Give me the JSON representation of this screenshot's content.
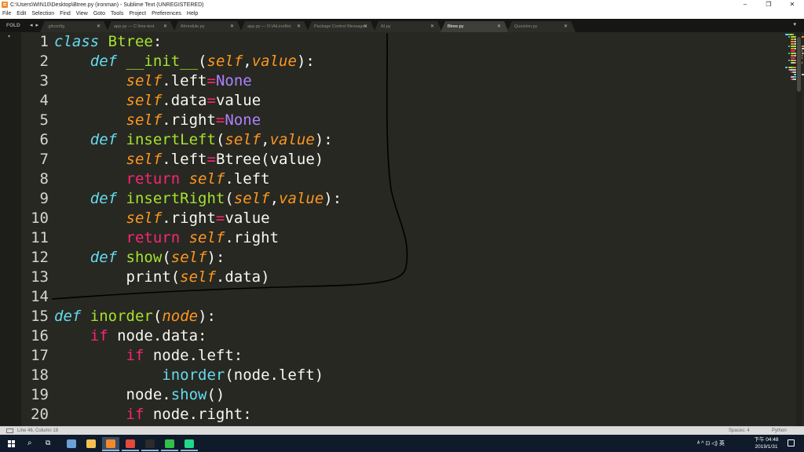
{
  "window": {
    "title": "C:\\Users\\WIN10\\Desktop\\Btree.py (ironman) - Sublime Text (UNREGISTERED)",
    "minimize": "–",
    "maximize": "❐",
    "close": "✕"
  },
  "menu": [
    "File",
    "Edit",
    "Selection",
    "Find",
    "View",
    "Goto",
    "Tools",
    "Project",
    "Preferences",
    "Help"
  ],
  "tabbar": {
    "folder_label": "FOLD",
    "nav": "◂ ▸",
    "tabs": [
      {
        "label": ".gitconfig",
        "active": false
      },
      {
        "label": "app.py — C:\\line-test",
        "active": false
      },
      {
        "label": "AImodule.py",
        "active": false
      },
      {
        "label": "app.py — D:\\AiLineBot",
        "active": false
      },
      {
        "label": "Package Control Messages",
        "active": false
      },
      {
        "label": "AI.py",
        "active": false
      },
      {
        "label": "Btree.py",
        "active": true
      },
      {
        "label": "Question.py",
        "active": false
      }
    ],
    "close_glyph": "✕",
    "dropdown": "▾"
  },
  "editor": {
    "language": "Python",
    "theme": {
      "background": "#272822",
      "keyword": "#f92672",
      "storage": "#66d9ef",
      "function": "#a6e22e",
      "self": "#fd971f",
      "constant": "#ae81ff",
      "text": "#f8f8f2"
    },
    "line_numbers": [
      "1",
      "2",
      "3",
      "4",
      "5",
      "6",
      "7",
      "8",
      "9",
      "10",
      "11",
      "12",
      "13",
      "14",
      "15",
      "16",
      "17",
      "18",
      "19",
      "20"
    ],
    "lines": [
      [
        [
          "k",
          "class"
        ],
        [
          "t",
          " "
        ],
        [
          "cls",
          "Btree"
        ],
        [
          "t",
          ":"
        ]
      ],
      [
        [
          "t",
          "    "
        ],
        [
          "k",
          "def"
        ],
        [
          "t",
          " "
        ],
        [
          "fn",
          "__init__"
        ],
        [
          "t",
          "("
        ],
        [
          "sf",
          "self"
        ],
        [
          "t",
          ","
        ],
        [
          "sf",
          "value"
        ],
        [
          "t",
          "):"
        ]
      ],
      [
        [
          "t",
          "        "
        ],
        [
          "sf",
          "self"
        ],
        [
          "t",
          ".left"
        ],
        [
          "op",
          "="
        ],
        [
          "cst",
          "None"
        ]
      ],
      [
        [
          "t",
          "        "
        ],
        [
          "sf",
          "self"
        ],
        [
          "t",
          ".data"
        ],
        [
          "op",
          "="
        ],
        [
          "t",
          "value"
        ]
      ],
      [
        [
          "t",
          "        "
        ],
        [
          "sf",
          "self"
        ],
        [
          "t",
          ".right"
        ],
        [
          "op",
          "="
        ],
        [
          "cst",
          "None"
        ]
      ],
      [
        [
          "t",
          "    "
        ],
        [
          "k",
          "def"
        ],
        [
          "t",
          " "
        ],
        [
          "fn",
          "insertLeft"
        ],
        [
          "t",
          "("
        ],
        [
          "sf",
          "self"
        ],
        [
          "t",
          ","
        ],
        [
          "sf",
          "value"
        ],
        [
          "t",
          "):"
        ]
      ],
      [
        [
          "t",
          "        "
        ],
        [
          "sf",
          "self"
        ],
        [
          "t",
          ".left"
        ],
        [
          "op",
          "="
        ],
        [
          "t",
          "Btree(value)"
        ]
      ],
      [
        [
          "t",
          "        "
        ],
        [
          "kw",
          "return"
        ],
        [
          "t",
          " "
        ],
        [
          "sf",
          "self"
        ],
        [
          "t",
          ".left"
        ]
      ],
      [
        [
          "t",
          "    "
        ],
        [
          "k",
          "def"
        ],
        [
          "t",
          " "
        ],
        [
          "fn",
          "insertRight"
        ],
        [
          "t",
          "("
        ],
        [
          "sf",
          "self"
        ],
        [
          "t",
          ","
        ],
        [
          "sf",
          "value"
        ],
        [
          "t",
          "):"
        ]
      ],
      [
        [
          "t",
          "        "
        ],
        [
          "sf",
          "self"
        ],
        [
          "t",
          ".right"
        ],
        [
          "op",
          "="
        ],
        [
          "t",
          "value"
        ]
      ],
      [
        [
          "t",
          "        "
        ],
        [
          "kw",
          "return"
        ],
        [
          "t",
          " "
        ],
        [
          "sf",
          "self"
        ],
        [
          "t",
          ".right"
        ]
      ],
      [
        [
          "t",
          "    "
        ],
        [
          "k",
          "def"
        ],
        [
          "t",
          " "
        ],
        [
          "fn",
          "show"
        ],
        [
          "t",
          "("
        ],
        [
          "sf",
          "self"
        ],
        [
          "t",
          "):"
        ]
      ],
      [
        [
          "t",
          "        "
        ],
        [
          "t",
          "print("
        ],
        [
          "sf",
          "self"
        ],
        [
          "t",
          ".data)"
        ]
      ],
      [
        [
          "t",
          ""
        ]
      ],
      [
        [
          "k",
          "def"
        ],
        [
          "t",
          " "
        ],
        [
          "fn",
          "inorder"
        ],
        [
          "t",
          "("
        ],
        [
          "sf",
          "node"
        ],
        [
          "t",
          "):"
        ]
      ],
      [
        [
          "t",
          "    "
        ],
        [
          "kw",
          "if"
        ],
        [
          "t",
          " node.data:"
        ]
      ],
      [
        [
          "t",
          "        "
        ],
        [
          "kw",
          "if"
        ],
        [
          "t",
          " node.left:"
        ]
      ],
      [
        [
          "t",
          "            "
        ],
        [
          "bi",
          "inorder"
        ],
        [
          "t",
          "(node.left)"
        ]
      ],
      [
        [
          "t",
          "        "
        ],
        [
          "t",
          "node."
        ],
        [
          "bi",
          "show"
        ],
        [
          "t",
          "()"
        ]
      ],
      [
        [
          "t",
          "        "
        ],
        [
          "kw",
          "if"
        ],
        [
          "t",
          " node.right:"
        ]
      ]
    ]
  },
  "statusbar": {
    "position": "Line 46, Column 18",
    "spaces": "Spaces: 4",
    "syntax": "Python"
  },
  "taskbar": {
    "apps": [
      {
        "name": "ie-icon",
        "color": "#6aa0d8",
        "active": false,
        "pinned": false
      },
      {
        "name": "file-explorer-icon",
        "color": "#f2c14e",
        "active": false,
        "pinned": false
      },
      {
        "name": "sublime-text-icon",
        "color": "#f18a2c",
        "active": true,
        "pinned": true
      },
      {
        "name": "chrome-icon",
        "color": "#e24a3b",
        "active": false,
        "pinned": true
      },
      {
        "name": "terminal-icon",
        "color": "#2b2b2b",
        "active": false,
        "pinned": true
      },
      {
        "name": "line-app-icon",
        "color": "#2fc246",
        "active": false,
        "pinned": true
      },
      {
        "name": "pycharm-icon",
        "color": "#21d789",
        "active": false,
        "pinned": true
      }
    ],
    "tray": "ᴬ ^ ⊡ ◁) 英",
    "time": "下午 04:48",
    "date": "2019/1/31"
  }
}
